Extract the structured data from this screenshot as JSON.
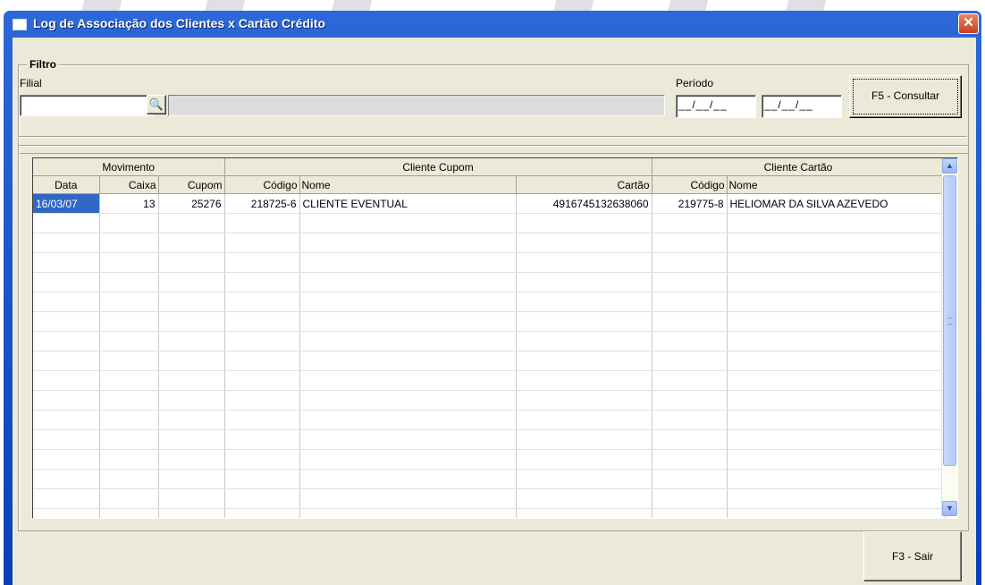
{
  "window": {
    "title": "Log de Associação dos Clientes x Cartão Crédito",
    "close_glyph": "✕",
    "icon": "window-app-icon"
  },
  "filter": {
    "legend": "Filtro",
    "filial_label": "Filial",
    "filial_value": "",
    "filial_name": "",
    "search_icon": "binoculars-icon",
    "search_glyph": "🔍",
    "periodo_label": "Período",
    "date_start": "__/__/__",
    "date_end": "__/__/__",
    "consult_label": "F5 - Consultar"
  },
  "grid": {
    "groups": [
      "Movimento",
      "Cliente Cupom",
      "Cliente Cartão"
    ],
    "columns": [
      "Data",
      "Caixa",
      "Cupom",
      "Código",
      "Nome",
      "Cartão",
      "Código",
      "Nome"
    ],
    "rows": [
      [
        "16/03/07",
        "13",
        "25276",
        "218725-6",
        "CLIENTE EVENTUAL",
        "4916745132638060",
        "219775-8",
        "HELIOMAR DA SILVA AZEVEDO"
      ]
    ],
    "empty_rows": 16,
    "scroll_up": "▲",
    "scroll_down": "▼"
  },
  "footer": {
    "exit_label": "F3 - Sair"
  },
  "colors": {
    "titlebar": "#0a3fb8",
    "selection": "#3167c6",
    "face": "#ece9d8"
  }
}
